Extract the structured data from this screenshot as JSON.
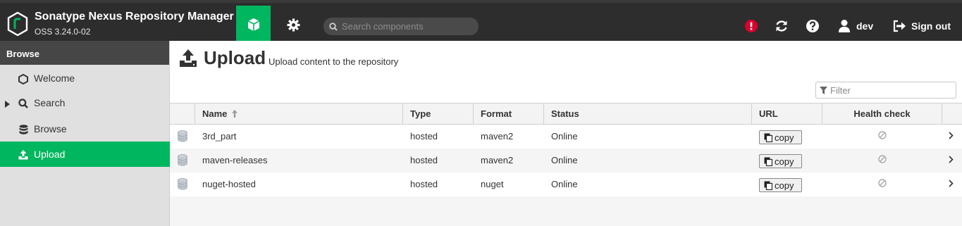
{
  "header": {
    "brand_title": "Sonatype Nexus Repository Manager",
    "brand_version": "OSS 3.24.0-02",
    "search_placeholder": "Search components",
    "user_name": "dev",
    "signout_label": "Sign out",
    "alert_color": "#d9002c",
    "accent": "#00b65f"
  },
  "sidebar": {
    "heading": "Browse",
    "items": [
      {
        "label": "Welcome",
        "icon": "hexagon-icon"
      },
      {
        "label": "Search",
        "icon": "search-icon",
        "expandable": true
      },
      {
        "label": "Browse",
        "icon": "database-icon"
      },
      {
        "label": "Upload",
        "icon": "upload-icon",
        "active": true
      }
    ]
  },
  "main": {
    "title": "Upload",
    "subtitle": "Upload content to the repository",
    "filter_placeholder": "Filter",
    "columns": {
      "name": "Name",
      "type": "Type",
      "format": "Format",
      "status": "Status",
      "url": "URL",
      "health": "Health check"
    },
    "copy_label": "copy",
    "rows": [
      {
        "name": "3rd_part",
        "type": "hosted",
        "format": "maven2",
        "status": "Online"
      },
      {
        "name": "maven-releases",
        "type": "hosted",
        "format": "maven2",
        "status": "Online"
      },
      {
        "name": "nuget-hosted",
        "type": "hosted",
        "format": "nuget",
        "status": "Online"
      }
    ]
  }
}
